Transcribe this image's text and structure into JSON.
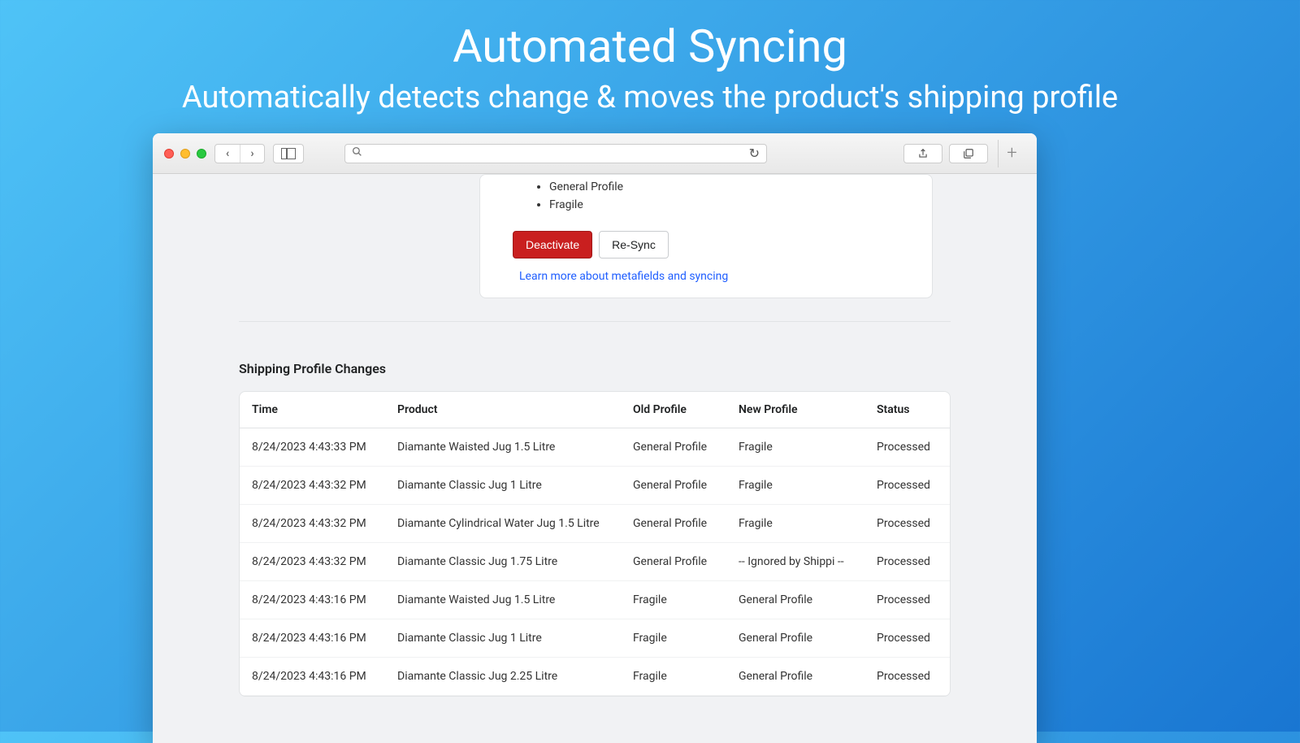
{
  "hero": {
    "title": "Automated Syncing",
    "subtitle": "Automatically detects change & moves the product's shipping profile"
  },
  "card": {
    "profiles": [
      "General Profile",
      "Fragile"
    ],
    "deactivate_label": "Deactivate",
    "resync_label": "Re-Sync",
    "learn_link": "Learn more about metafields and syncing"
  },
  "section_title": "Shipping Profile Changes",
  "table": {
    "headers": {
      "time": "Time",
      "product": "Product",
      "old_profile": "Old Profile",
      "new_profile": "New Profile",
      "status": "Status"
    },
    "rows": [
      {
        "time": "8/24/2023 4:43:33 PM",
        "product": "Diamante Waisted Jug 1.5 Litre",
        "old": "General Profile",
        "new": "Fragile",
        "status": "Processed"
      },
      {
        "time": "8/24/2023 4:43:32 PM",
        "product": "Diamante Classic Jug 1 Litre",
        "old": "General Profile",
        "new": "Fragile",
        "status": "Processed"
      },
      {
        "time": "8/24/2023 4:43:32 PM",
        "product": "Diamante Cylindrical Water Jug 1.5 Litre",
        "old": "General Profile",
        "new": "Fragile",
        "status": "Processed"
      },
      {
        "time": "8/24/2023 4:43:32 PM",
        "product": "Diamante Classic Jug 1.75 Litre",
        "old": "General Profile",
        "new": "-- Ignored by Shippi --",
        "status": "Processed"
      },
      {
        "time": "8/24/2023 4:43:16 PM",
        "product": "Diamante Waisted Jug 1.5 Litre",
        "old": "Fragile",
        "new": "General Profile",
        "status": "Processed"
      },
      {
        "time": "8/24/2023 4:43:16 PM",
        "product": "Diamante Classic Jug 1 Litre",
        "old": "Fragile",
        "new": "General Profile",
        "status": "Processed"
      },
      {
        "time": "8/24/2023 4:43:16 PM",
        "product": "Diamante Classic Jug 2.25 Litre",
        "old": "Fragile",
        "new": "General Profile",
        "status": "Processed"
      }
    ]
  }
}
